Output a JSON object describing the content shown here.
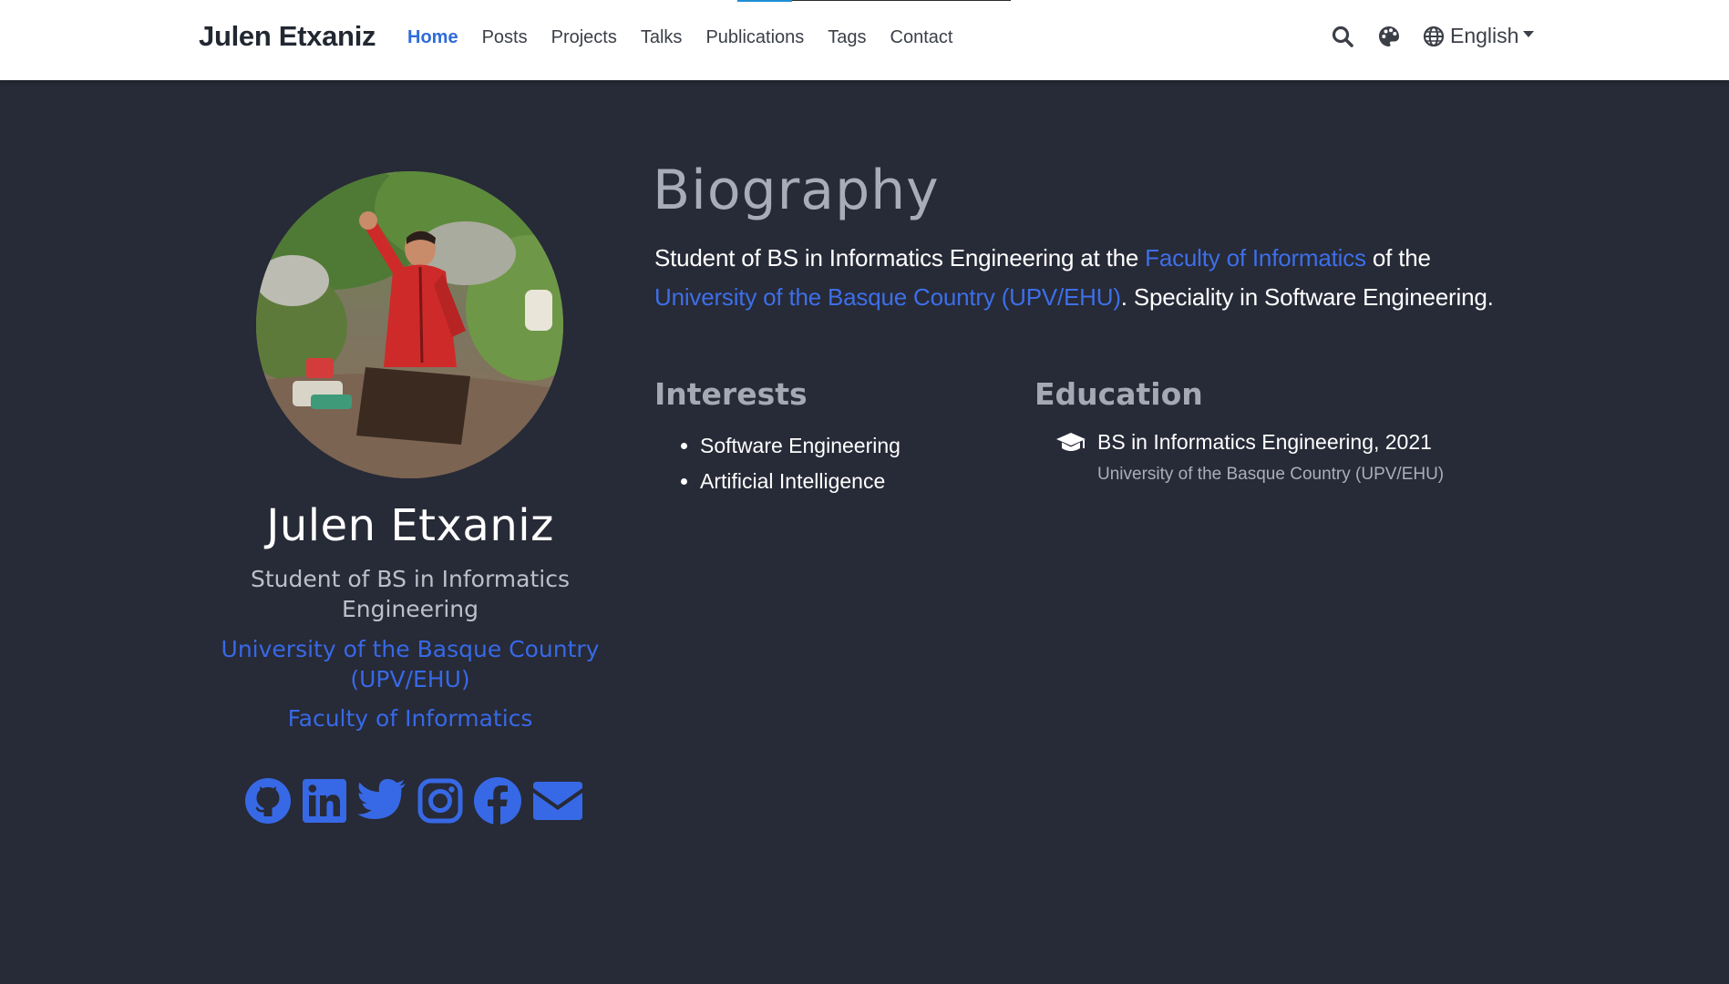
{
  "navbar": {
    "brand": "Julen Etxaniz",
    "links": [
      {
        "label": "Home",
        "active": true
      },
      {
        "label": "Posts",
        "active": false
      },
      {
        "label": "Projects",
        "active": false
      },
      {
        "label": "Talks",
        "active": false
      },
      {
        "label": "Publications",
        "active": false
      },
      {
        "label": "Tags",
        "active": false
      },
      {
        "label": "Contact",
        "active": false
      }
    ],
    "icons": [
      "search-icon",
      "palette-icon",
      "globe-icon"
    ],
    "language": "English"
  },
  "profile": {
    "name": "Julen Etxaniz",
    "role": "Student of BS in Informatics Engineering",
    "organizations": [
      "University of the Basque Country (UPV/EHU)",
      "Faculty of Informatics"
    ],
    "socials": [
      "github-icon",
      "linkedin-icon",
      "twitter-icon",
      "instagram-icon",
      "facebook-icon",
      "envelope-icon"
    ]
  },
  "biography": {
    "title": "Biography",
    "text_1": "Student of BS in Informatics Engineering at the ",
    "link_1": "Faculty of Informatics",
    "text_2": " of the ",
    "link_2": "University of the Basque Country (UPV/EHU)",
    "text_3": ". Speciality in Software Engineering."
  },
  "interests": {
    "title": "Interests",
    "items": [
      "Software Engineering",
      "Artificial Intelligence"
    ]
  },
  "education": {
    "title": "Education",
    "icon": "graduation-cap-icon",
    "degree": "BS in Informatics Engineering, 2021",
    "institution": "University of the Basque Country (UPV/EHU)"
  },
  "colors": {
    "background": "#272a37",
    "accent": "#3769e6",
    "navbar": "#ffffff"
  }
}
